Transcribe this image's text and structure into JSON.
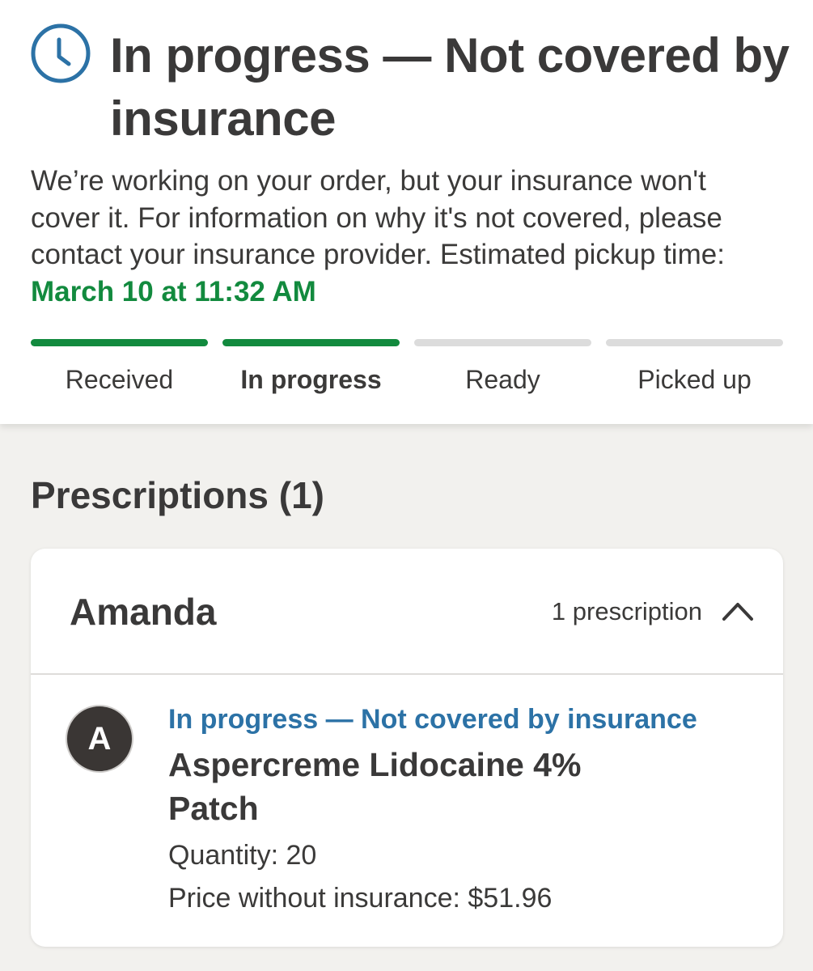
{
  "status": {
    "icon": "clock-icon",
    "title": "In progress — Not covered by insurance",
    "description": "We’re working on your order, but your insurance won't cover it. For information on why it's not covered, please contact your insurance provider.",
    "pickup_label": "Estimated pickup time:",
    "pickup_time": "March 10 at 11:32 AM",
    "accent_color": "#128a3e",
    "icon_color": "#2c72a6",
    "steps": [
      {
        "label": "Received",
        "complete": true,
        "current": false
      },
      {
        "label": "In progress",
        "complete": true,
        "current": true
      },
      {
        "label": "Ready",
        "complete": false,
        "current": false
      },
      {
        "label": "Picked up",
        "complete": false,
        "current": false
      }
    ]
  },
  "prescriptions": {
    "section_title": "Prescriptions (1)",
    "patient": {
      "name": "Amanda",
      "count_label": "1 prescription",
      "expanded": true,
      "toggle_icon": "chevron-up-icon",
      "items": [
        {
          "avatar_initial": "A",
          "status": "In progress — Not covered by insurance",
          "drug_name": "Aspercreme Lidocaine 4% Patch",
          "quantity": "Quantity: 20",
          "price": "Price without insurance: $51.96",
          "status_color": "#2c72a6"
        }
      ]
    }
  }
}
